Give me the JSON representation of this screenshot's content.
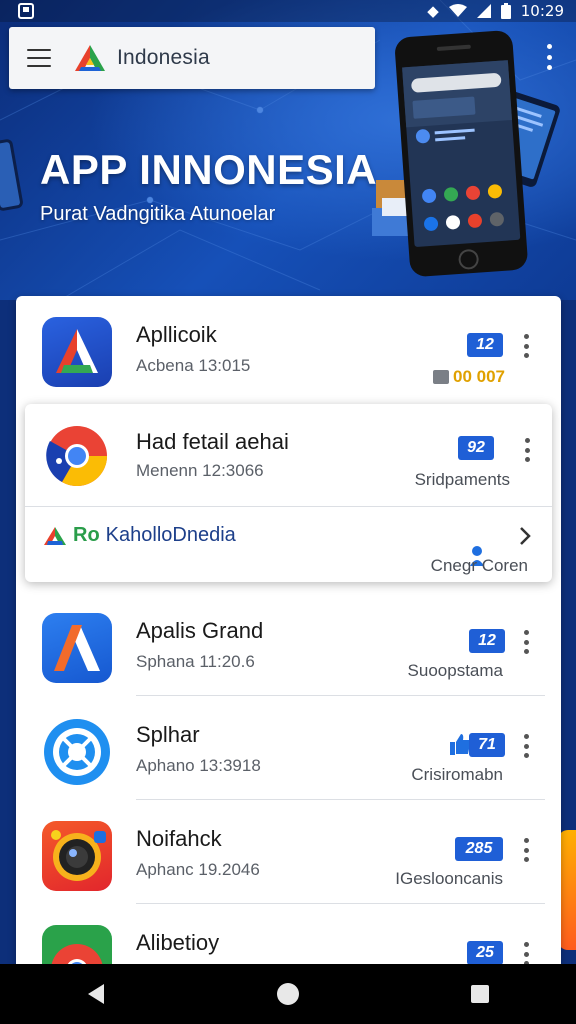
{
  "status_bar": {
    "time": "10:29",
    "icons": [
      "app-notification-icon",
      "vpn-key-icon",
      "wifi-icon",
      "signal-icon",
      "battery-icon"
    ]
  },
  "search_bar": {
    "menu_icon": "hamburger-menu-icon",
    "logo_icon": "app-logo-icon",
    "title": "Indonesia"
  },
  "hero": {
    "title": "APP INNONESIA",
    "subtitle": "Purat Vadngitika Atunoelar",
    "colors": {
      "background": "#1650b8",
      "accent": "#2f6fd6"
    }
  },
  "apps": [
    {
      "name": "Apllicoik",
      "subtitle": "Acbena 13:015",
      "badge": "12",
      "right_text": "00 007",
      "icon": "blue-a-logo-icon"
    },
    {
      "name": "Had fetail aehai",
      "subtitle": "Menenn 12:3066",
      "badge": "92",
      "right_text": "Sridpaments",
      "icon": "chrome-style-icon",
      "expanded": {
        "link_prefix": "Ro",
        "link_label": "KaholloDnedia",
        "action_label": "Cnegr Coren"
      }
    },
    {
      "name": "Apalis Grand",
      "subtitle": "Sphana 11:20.6",
      "badge": "12",
      "right_text": "Suoopstama",
      "icon": "orange-a-logo-icon"
    },
    {
      "name": "Splhar",
      "subtitle": "Aphano 13:3918",
      "badge": "71",
      "right_text": "Crisiromabn",
      "icon": "blue-lens-icon"
    },
    {
      "name": "Noifahck",
      "subtitle": "Aphanc 19.2046",
      "badge": "285",
      "right_text": "IGeslooncanis",
      "icon": "camera-lens-icon"
    },
    {
      "name": "Alibetioy",
      "subtitle": "",
      "badge": "25",
      "right_text": "",
      "icon": "chrome-icon"
    }
  ],
  "nav_bar": {
    "back": "back-icon",
    "home": "home-icon",
    "recents": "recents-icon"
  }
}
